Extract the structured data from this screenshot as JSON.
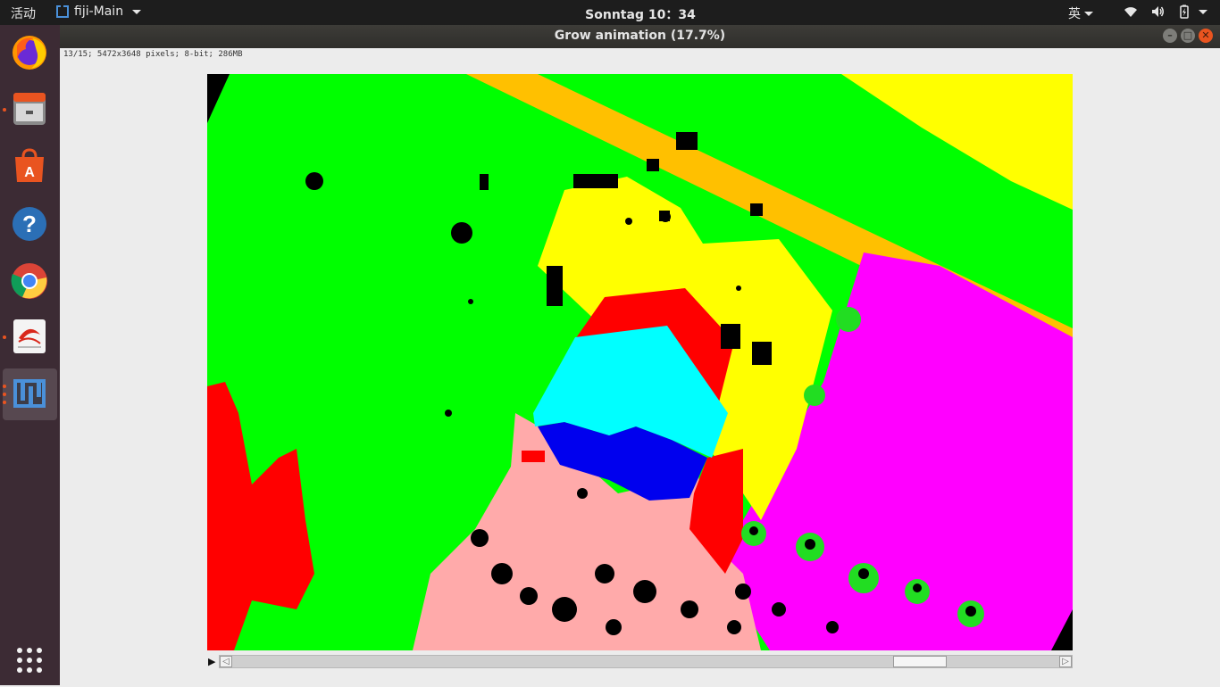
{
  "topbar": {
    "activities": "活动",
    "app_menu_label": "fiji-Main",
    "clock": "Sonntag 10：34",
    "input_method": "英"
  },
  "window": {
    "title": "Grow animation (17.7%)",
    "info_line": "13/15; 5472x3648 pixels; 8-bit; 286MB"
  },
  "dock": {
    "items": [
      {
        "name": "firefox",
        "icon": "firefox-icon"
      },
      {
        "name": "files",
        "icon": "files-icon"
      },
      {
        "name": "software",
        "icon": "software-center-icon"
      },
      {
        "name": "help",
        "icon": "help-icon"
      },
      {
        "name": "chrome",
        "icon": "chrome-icon"
      },
      {
        "name": "document-viewer",
        "icon": "document-viewer-icon"
      },
      {
        "name": "fiji",
        "icon": "fiji-icon"
      }
    ],
    "apps_grid_icon": "apps-grid-icon"
  },
  "segmentation_colors": {
    "background": "#00ff00",
    "road": "#ffc000",
    "yellow_region": "#ffff00",
    "roof_red": "#ff0000",
    "roof_cyan": "#00ffff",
    "roof_blue": "#0000ee",
    "pink_region": "#ffaaaa",
    "magenta_region": "#ff00ff",
    "noise": "#000000"
  }
}
